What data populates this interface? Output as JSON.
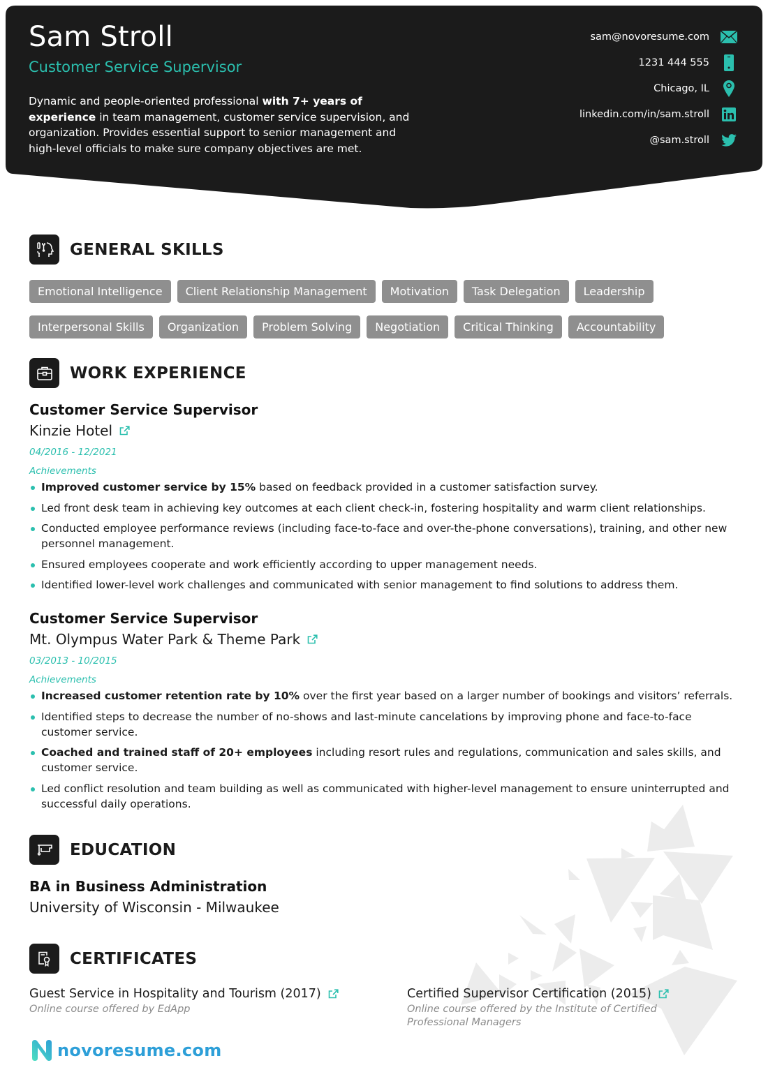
{
  "colors": {
    "accent": "#2bbfae",
    "header_bg": "#1b1b1b",
    "skill_bg": "#8f8f8f",
    "logo": "#2d9fd8"
  },
  "header": {
    "name": "Sam Stroll",
    "title": "Customer Service Supervisor",
    "summary": {
      "part1": "Dynamic and people-oriented professional ",
      "bold": "with 7+ years of experience",
      "part2": " in team management, customer service supervision, and organization. Provides essential support to senior management and high-level officials to make sure company objectives are met."
    },
    "contacts": [
      {
        "text": "sam@novoresume.com",
        "icon": "email-icon"
      },
      {
        "text": "1231 444 555",
        "icon": "phone-icon"
      },
      {
        "text": "Chicago, IL",
        "icon": "location-icon"
      },
      {
        "text": "linkedin.com/in/sam.stroll",
        "icon": "linkedin-icon"
      },
      {
        "text": "@sam.stroll",
        "icon": "twitter-icon"
      }
    ]
  },
  "skills": {
    "heading": "GENERAL SKILLS",
    "icon": "skills-icon",
    "items": [
      "Emotional Intelligence",
      "Client Relationship Management",
      "Motivation",
      "Task Delegation",
      "Leadership",
      "Interpersonal Skills",
      "Organization",
      "Problem Solving",
      "Negotiation",
      "Critical Thinking",
      "Accountability"
    ]
  },
  "work": {
    "heading": "WORK EXPERIENCE",
    "icon": "briefcase-icon",
    "jobs": [
      {
        "title": "Customer Service Supervisor",
        "company": "Kinzie Hotel",
        "dates": "04/2016 - 12/2021",
        "label": "Achievements",
        "bullets": [
          {
            "bold": "Improved customer service by 15%",
            "text": " based on feedback provided in a customer satisfaction survey."
          },
          {
            "bold": "",
            "text": "Led front desk team in achieving key outcomes at each client check-in, fostering hospitality and warm client relationships."
          },
          {
            "bold": "",
            "text": "Conducted employee performance reviews (including face-to-face and over-the-phone conversations), training, and other new personnel management."
          },
          {
            "bold": "",
            "text": "Ensured employees cooperate and work efficiently according to upper management needs."
          },
          {
            "bold": "",
            "text": "Identified lower-level work challenges and communicated with senior management to find solutions to address them."
          }
        ]
      },
      {
        "title": "Customer Service Supervisor",
        "company": "Mt. Olympus Water Park & Theme Park",
        "dates": "03/2013 - 10/2015",
        "label": "Achievements",
        "bullets": [
          {
            "bold": "Increased customer retention rate by 10%",
            "text": " over the first year based on a larger number of bookings and visitors’ referrals."
          },
          {
            "bold": "",
            "text": "Identified steps to decrease the number of no-shows and last-minute cancelations by improving phone and face-to-face customer service."
          },
          {
            "bold": "Coached and trained staff of 20+ employees",
            "text": " including resort rules and regulations, communication and sales skills, and customer service."
          },
          {
            "bold": "",
            "text": "Led conflict resolution and team building as well as communicated with higher-level management to ensure uninterrupted and successful daily operations."
          }
        ]
      }
    ]
  },
  "education": {
    "heading": "EDUCATION",
    "icon": "graduation-cap-icon",
    "degree": "BA in Business Administration",
    "school": "University of Wisconsin - Milwaukee"
  },
  "certificates": {
    "heading": "CERTIFICATES",
    "icon": "certificate-icon",
    "items": [
      {
        "name": "Guest Service in Hospitality and Tourism (2017)",
        "desc": "Online course offered by EdApp"
      },
      {
        "name": "Certified Supervisor Certification (2015)",
        "desc": "Online course offered by the Institute of Certified Professional Managers"
      }
    ]
  },
  "footer": {
    "logo_text": "novoresume.com"
  }
}
